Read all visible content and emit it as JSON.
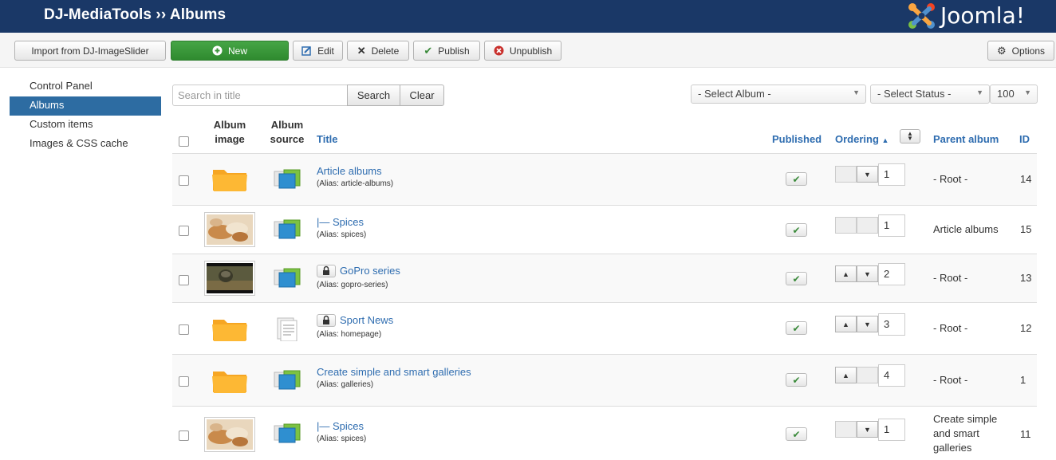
{
  "header": {
    "title": "DJ-MediaTools ›› Albums",
    "brand": "Joomla!"
  },
  "toolbar": {
    "import_label": "Import from DJ-ImageSlider",
    "new_label": "New",
    "edit_label": "Edit",
    "delete_label": "Delete",
    "publish_label": "Publish",
    "unpublish_label": "Unpublish",
    "options_label": "Options"
  },
  "sidebar": {
    "items": [
      {
        "label": "Control Panel"
      },
      {
        "label": "Albums"
      },
      {
        "label": "Custom items"
      },
      {
        "label": "Images & CSS cache"
      }
    ]
  },
  "filters": {
    "search_placeholder": "Search in title",
    "search_label": "Search",
    "clear_label": "Clear",
    "album_select": "- Select Album -",
    "status_select": "- Select Status -",
    "limit_select": "100"
  },
  "table": {
    "headers": {
      "album_image_1": "Album",
      "album_image_2": "image",
      "album_source_1": "Album",
      "album_source_2": "source",
      "title": "Title",
      "published": "Published",
      "ordering": "Ordering",
      "parent": "Parent album",
      "id": "ID"
    },
    "rows": [
      {
        "title": "Article albums",
        "alias": "(Alias: article-albums)",
        "order": "1",
        "parent": "- Root -",
        "id": "14"
      },
      {
        "title": "|— Spices",
        "alias": "(Alias: spices)",
        "order": "1",
        "parent": "Article albums",
        "id": "15"
      },
      {
        "title": "GoPro series",
        "alias": "(Alias: gopro-series)",
        "order": "2",
        "parent": "- Root -",
        "id": "13"
      },
      {
        "title": "Sport News",
        "alias": "(Alias: homepage)",
        "order": "3",
        "parent": "- Root -",
        "id": "12"
      },
      {
        "title": "Create simple and smart galleries",
        "alias": "(Alias: galleries)",
        "order": "4",
        "parent": "- Root -",
        "id": "1"
      },
      {
        "title": "|— Spices",
        "alias": "(Alias: spices)",
        "order": "1",
        "parent_1": "Create simple",
        "parent_2": "and smart",
        "parent_3": "galleries",
        "id": "11"
      }
    ]
  },
  "colors": {
    "header_bg": "#1a3867",
    "accent": "#2d6ca2",
    "link": "#2f6db0",
    "green": "#46a546"
  }
}
